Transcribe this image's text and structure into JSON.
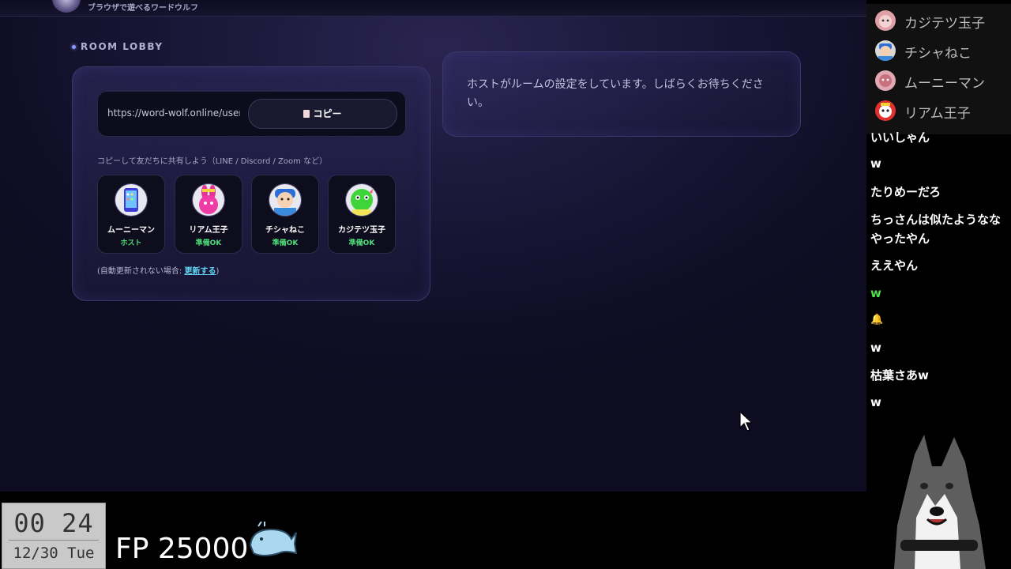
{
  "header": {
    "tagline": "ブラウザで遊べるワードウルフ"
  },
  "lobby": {
    "label": "ROOM LOBBY",
    "url": "https://word-wolf.online/user...",
    "copy_label": "コピー",
    "share_hint": "コピーして友だちに共有しよう（LINE / Discord / Zoom など）",
    "players": [
      {
        "name": "ムーニーマン",
        "status": "ホスト",
        "status_color": "#4ee07a"
      },
      {
        "name": "リアム王子",
        "status": "準備OK",
        "status_color": "#4ee07a"
      },
      {
        "name": "チシャねこ",
        "status": "準備OK",
        "status_color": "#4ee07a"
      },
      {
        "name": "カジテツ玉子",
        "status": "準備OK",
        "status_color": "#4ee07a"
      }
    ],
    "refresh_prefix": "(自動更新されない場合:",
    "refresh_link": "更新する",
    "refresh_suffix": ")"
  },
  "host_message": "ホストがルームの設定をしています。しばらくお待ちください。",
  "viewers": [
    {
      "name": "カジテツ玉子",
      "icon": "egg-avatar-icon"
    },
    {
      "name": "チシャねこ",
      "icon": "cat-avatar-icon"
    },
    {
      "name": "ムーニーマン",
      "icon": "moon-avatar-icon"
    },
    {
      "name": "リアム王子",
      "icon": "prince-avatar-icon"
    }
  ],
  "chat_messages": [
    {
      "text": "いいしゃん",
      "color": "#ffffff"
    },
    {
      "text": "w",
      "color": "#ffffff"
    },
    {
      "text": "たりめーだろ",
      "color": "#ffffff"
    },
    {
      "text": "ちっさんは似たようなな",
      "color": "#ffffff"
    },
    {
      "text": "やったやん",
      "color": "#ffffff"
    },
    {
      "text": "ええやん",
      "color": "#ffffff"
    },
    {
      "text": "w",
      "color": "#4ee04a"
    },
    {
      "text": "🔔",
      "color": "#ffd84a"
    },
    {
      "text": "w",
      "color": "#ffffff"
    },
    {
      "text": "枯葉さあw",
      "color": "#ffffff"
    },
    {
      "text": "w",
      "color": "#ffffff"
    }
  ],
  "clock": {
    "time": "00 24",
    "date": "12/30 Tue"
  },
  "fp": {
    "label": "FP 25000"
  }
}
